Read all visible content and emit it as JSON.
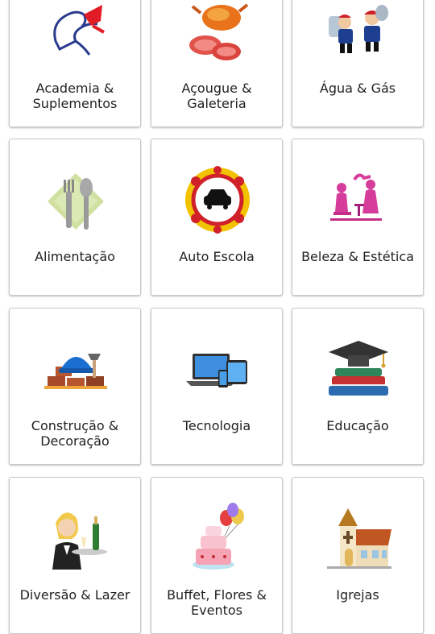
{
  "categories": [
    {
      "label": "Academia & Suplementos",
      "icon": "fitness-man-icon"
    },
    {
      "label": "Açougue & Galeteria",
      "icon": "roast-chicken-steak-icon"
    },
    {
      "label": "Água & Gás",
      "icon": "delivery-men-icon"
    },
    {
      "label": "Alimentação",
      "icon": "fork-spoon-icon"
    },
    {
      "label": "Auto Escola",
      "icon": "traffic-signs-car-icon"
    },
    {
      "label": "Beleza & Estética",
      "icon": "salon-women-icon"
    },
    {
      "label": "Construção & Decoração",
      "icon": "hard-hat-bricks-icon"
    },
    {
      "label": "Tecnologia",
      "icon": "laptop-devices-icon"
    },
    {
      "label": "Educação",
      "icon": "graduation-cap-books-icon"
    },
    {
      "label": "Diversão & Lazer",
      "icon": "waiter-champagne-icon"
    },
    {
      "label": "Buffet, Flores & Eventos",
      "icon": "cake-balloons-icon"
    },
    {
      "label": "Igrejas",
      "icon": "church-icon"
    }
  ]
}
